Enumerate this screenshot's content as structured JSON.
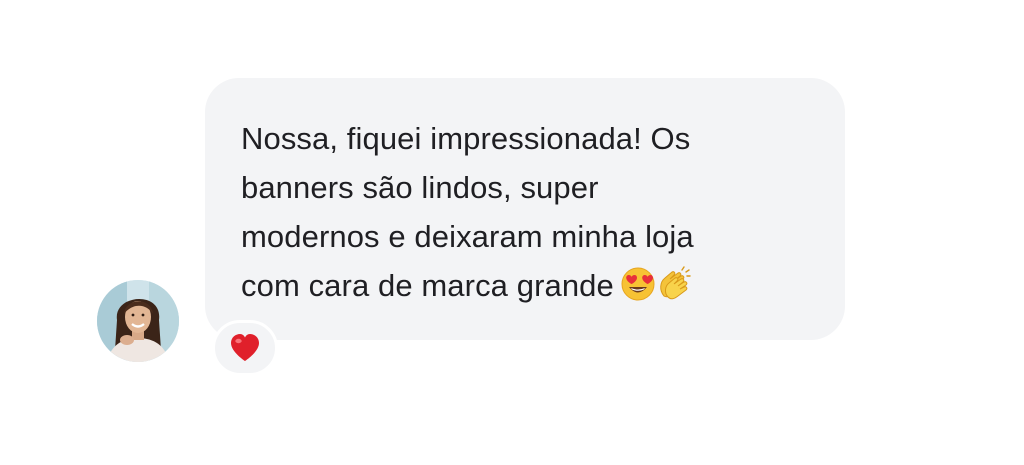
{
  "message": {
    "text": "Nossa, fiquei impressionada! Os\nbanners são lindos, super\nmodernos e deixaram minha loja\ncom cara de marca grande",
    "emojis": [
      "heart-eyes-emoji",
      "clapping-hands-emoji"
    ]
  },
  "reaction": {
    "icon": "red-heart-icon",
    "color": "#e0202b"
  },
  "colors": {
    "bubble": "#f3f4f6",
    "text": "#1f1f23",
    "background": "#ffffff"
  }
}
